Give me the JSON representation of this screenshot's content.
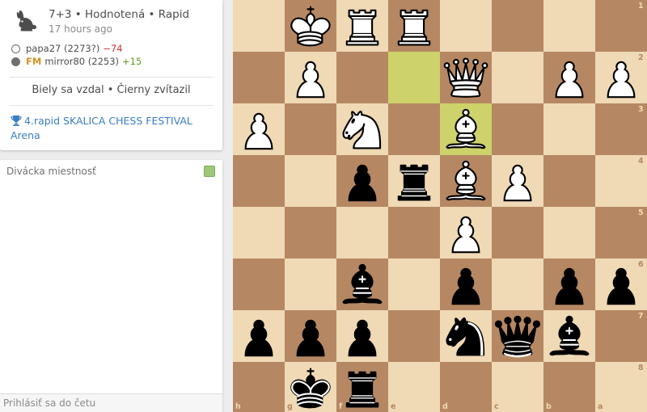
{
  "game": {
    "speed": "7+3 • Hodnotená • Rapid",
    "time": "17 hours ago",
    "white": {
      "name": "papa27 (2273?)",
      "diff": "−74"
    },
    "black": {
      "title": "FM",
      "name": "mirror80 (2253)",
      "diff": "+15"
    },
    "result": "Biely sa vzdal • Čierny zvítazil",
    "tournament": "4.rapid SKALICA CHESS FESTIVAL Arena"
  },
  "chat": {
    "title": "Divácka miestnosť",
    "placeholder": "Prihlásiť sa do četu"
  },
  "colors": {
    "light_square": "#f0d9b5",
    "dark_square": "#b58863",
    "highlight": "#cdd26a",
    "link": "#3a7ec2",
    "rating_loss": "#cc3333",
    "rating_gain": "#629924"
  },
  "board": {
    "orientation": "black",
    "files": [
      "h",
      "g",
      "f",
      "e",
      "d",
      "c",
      "b",
      "a"
    ],
    "ranks": [
      "1",
      "2",
      "3",
      "4",
      "5",
      "6",
      "7",
      "8"
    ],
    "last_move": [
      "e2",
      "d3"
    ],
    "pieces": [
      {
        "square": "g1",
        "piece": "K",
        "color": "white"
      },
      {
        "square": "f1",
        "piece": "R",
        "color": "white"
      },
      {
        "square": "e1",
        "piece": "R",
        "color": "white"
      },
      {
        "square": "g2",
        "piece": "P",
        "color": "white"
      },
      {
        "square": "d2",
        "piece": "Q",
        "color": "white"
      },
      {
        "square": "b2",
        "piece": "P",
        "color": "white"
      },
      {
        "square": "a2",
        "piece": "P",
        "color": "white"
      },
      {
        "square": "h3",
        "piece": "P",
        "color": "white"
      },
      {
        "square": "f3",
        "piece": "N",
        "color": "white"
      },
      {
        "square": "d3",
        "piece": "B",
        "color": "white"
      },
      {
        "square": "d4",
        "piece": "B",
        "color": "white"
      },
      {
        "square": "c4",
        "piece": "P",
        "color": "white"
      },
      {
        "square": "d5",
        "piece": "P",
        "color": "white"
      },
      {
        "square": "f4",
        "piece": "P",
        "color": "black"
      },
      {
        "square": "e4",
        "piece": "R",
        "color": "black"
      },
      {
        "square": "f6",
        "piece": "B",
        "color": "black"
      },
      {
        "square": "d6",
        "piece": "P",
        "color": "black"
      },
      {
        "square": "b6",
        "piece": "P",
        "color": "black"
      },
      {
        "square": "a6",
        "piece": "P",
        "color": "black"
      },
      {
        "square": "h7",
        "piece": "P",
        "color": "black"
      },
      {
        "square": "g7",
        "piece": "P",
        "color": "black"
      },
      {
        "square": "f7",
        "piece": "P",
        "color": "black"
      },
      {
        "square": "d7",
        "piece": "N",
        "color": "black"
      },
      {
        "square": "c7",
        "piece": "Q",
        "color": "black"
      },
      {
        "square": "b7",
        "piece": "B",
        "color": "black"
      },
      {
        "square": "g8",
        "piece": "K",
        "color": "black"
      },
      {
        "square": "f8",
        "piece": "R",
        "color": "black"
      }
    ]
  }
}
